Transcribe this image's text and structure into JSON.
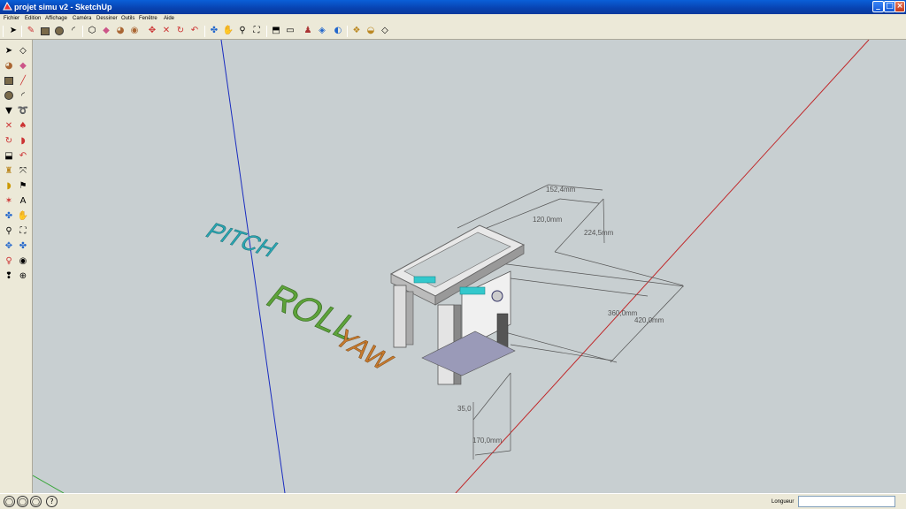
{
  "window": {
    "title": "projet simu v2 - SketchUp"
  },
  "menu": [
    "Fichier",
    "Edition",
    "Affichage",
    "Caméra",
    "Dessiner",
    "Outils",
    "Fenêtre",
    "Aide"
  ],
  "toolbar": {
    "icons": [
      "select-icon",
      "pencil-icon",
      "rectangle-icon",
      "circle-icon",
      "arc-icon",
      "make-component-icon",
      "eraser-icon",
      "paint-bucket-icon",
      "push-pull-icon",
      "move-icon",
      "rotate-icon",
      "follow-me-icon",
      "orbit-icon",
      "pan-icon",
      "zoom-icon",
      "zoom-extents-icon",
      "iso-view-icon",
      "top-view-icon",
      "front-view-icon",
      "right-view-icon",
      "back-view-icon",
      "left-view-icon",
      "components-icon",
      "materials-icon",
      "styles-icon"
    ]
  },
  "lefttools": {
    "icons": [
      "select-icon",
      "make-component-icon",
      "paint-bucket-icon",
      "eraser-icon",
      "rectangle-icon",
      "line-icon",
      "circle-icon",
      "arc-icon",
      "polygon-icon",
      "freehand-icon",
      "move-icon",
      "push-pull-icon",
      "rotate-icon",
      "follow-me-icon",
      "scale-icon",
      "offset-icon",
      "tape-measure-icon",
      "dimension-icon",
      "protractor-icon",
      "text-icon",
      "axes-icon",
      "3d-text-icon",
      "orbit-icon",
      "pan-icon",
      "zoom-icon",
      "zoom-window-icon",
      "zoom-extents-icon",
      "previous-view-icon",
      "position-camera-icon",
      "look-around-icon",
      "walk-icon",
      "section-plane-icon"
    ]
  },
  "viewport": {
    "dimensions": {
      "d1": "152,4mm",
      "d2": "120,0mm",
      "d3": "224,5mm",
      "d4": "360,0mm",
      "d5": "420,0mm",
      "d6": "35,0",
      "d7": "170,0mm"
    },
    "labels": {
      "pitch": "PITCH",
      "roll": "ROLL",
      "yaw": "YAW"
    },
    "colors": {
      "pitch": "#2aa7b3",
      "roll": "#5da23a",
      "yaw": "#c77a2e",
      "blue_axis": "#1a2cc0",
      "red_axis": "#c0282a",
      "green_axis": "#3aa63a",
      "background": "#c8cfd1"
    }
  },
  "status": {
    "measure_label": "Longueur",
    "measure_value": ""
  }
}
